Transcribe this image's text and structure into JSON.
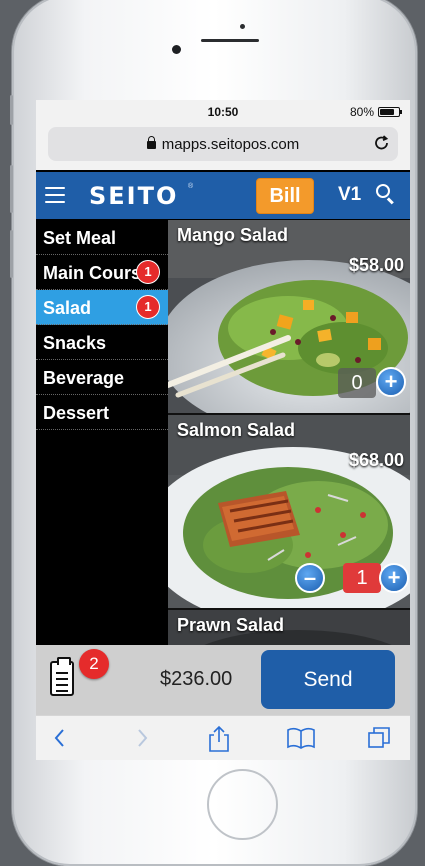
{
  "status_bar": {
    "time": "10:50",
    "battery_text": "80%",
    "battery_level": 0.8
  },
  "browser": {
    "url": "mapps.seitopos.com"
  },
  "app_bar": {
    "logo": "SEITO",
    "logo_mark": "®",
    "bill_label": "Bill",
    "table_label": "V1"
  },
  "categories": [
    {
      "label": "Set Meal",
      "badge": ""
    },
    {
      "label": "Main Course",
      "badge": "1"
    },
    {
      "label": "Salad",
      "badge": "1",
      "active": true
    },
    {
      "label": "Snacks",
      "badge": ""
    },
    {
      "label": "Beverage",
      "badge": ""
    },
    {
      "label": "Dessert",
      "badge": ""
    }
  ],
  "items": [
    {
      "name": "Mango Salad",
      "price": "$58.00",
      "quantity": "0"
    },
    {
      "name": "Salmon Salad",
      "price": "$68.00",
      "quantity": "1"
    },
    {
      "name": "Prawn Salad",
      "price": "",
      "quantity": ""
    }
  ],
  "footer": {
    "cart_count": "2",
    "total": "$236.00",
    "send_label": "Send"
  },
  "colors": {
    "brand_blue": "#1f5ea8",
    "bill_orange": "#f39a2b",
    "active_category": "#2f9fe3",
    "badge_red": "#e52b2b"
  },
  "icons": [
    "hamburger-icon",
    "search-icon",
    "lock-icon",
    "reload-icon",
    "clipboard-icon",
    "plus-icon",
    "minus-icon",
    "back-icon",
    "forward-icon",
    "share-icon",
    "bookmarks-icon",
    "tabs-icon"
  ]
}
